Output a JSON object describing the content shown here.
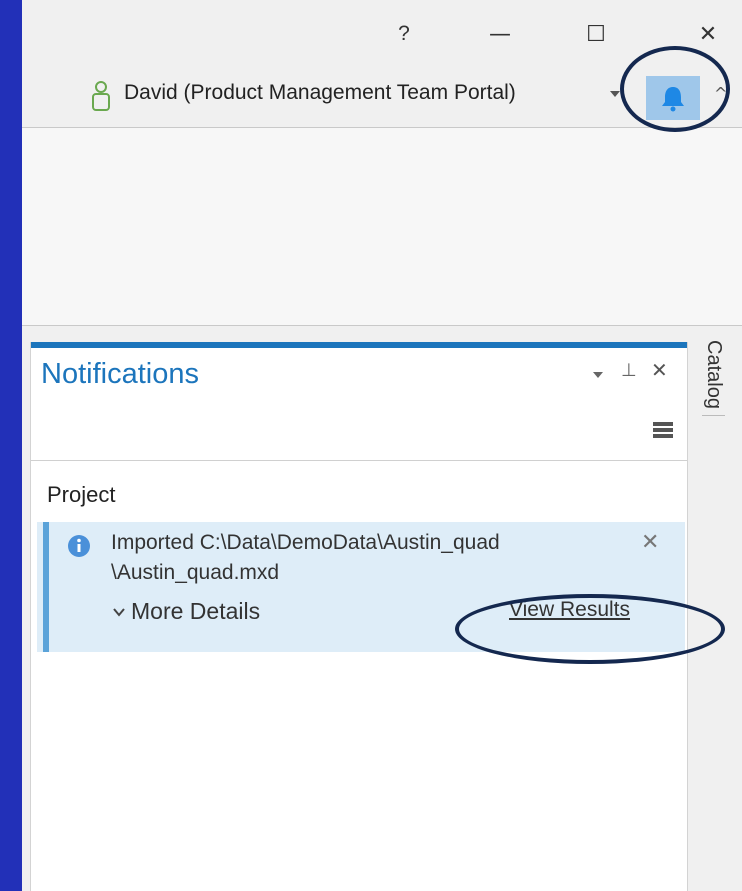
{
  "titlebar": {
    "help_label": "?",
    "minimize_label": "—",
    "maximize_label": "☐",
    "close_label": "✕"
  },
  "account": {
    "user_label": "David (Product Management Team Portal)"
  },
  "notifications_pane": {
    "title": "Notifications",
    "group_heading": "Project",
    "items": [
      {
        "message": "Imported C:\\Data\\DemoData\\Austin_quad \\Austin_quad.mxd",
        "details_label": "More Details",
        "action_label": "View Results"
      }
    ]
  },
  "side_tabs": {
    "catalog_label": "Catalog"
  },
  "colors": {
    "accent": "#1c75bc",
    "card_background": "#deedf8",
    "bell_highlight": "#9fc7ea",
    "ring": "#14284f",
    "outer_background": "#2230b8"
  },
  "icons": [
    "user-icon",
    "bell-icon",
    "info-icon",
    "chevron-down-icon",
    "pin-icon",
    "close-icon",
    "hamburger-icon"
  ]
}
